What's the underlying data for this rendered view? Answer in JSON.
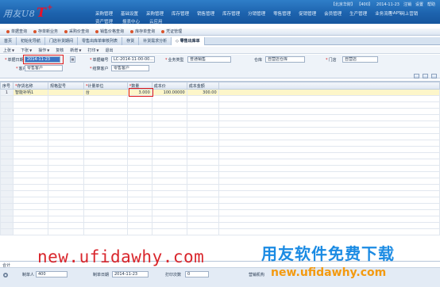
{
  "app": {
    "logo_text": "用友U8",
    "logo_mark": "T",
    "logo_plus": "+",
    "user_bar": [
      "【北京华财】",
      "【400】",
      "2014-11-23",
      "注销",
      "设置",
      "帮助"
    ],
    "shortcut": "T-APS"
  },
  "topnav": {
    "row1": [
      "采购管理",
      "基础设置",
      "采购管理",
      "库存管理",
      "销售管理",
      "库存管理",
      "分销管理",
      "零售管理",
      "促销管理",
      "会员管理",
      "生产管理",
      "业务流程",
      "网上营销"
    ],
    "row2": [
      "资产管理",
      "报表中心",
      "云应用"
    ]
  },
  "quickbar": {
    "items": [
      "单据查询",
      "存单新业务",
      "采购价查询",
      "销售价格查询",
      "库存单查询",
      "凭证管理"
    ]
  },
  "tabs": {
    "items": [
      "首页",
      "初始化导航",
      "门店补货期间",
      "零售出库单审核列表",
      "存货",
      "补货需求分析",
      "零售出库单"
    ],
    "active_index": 6
  },
  "toolbar": {
    "items": [
      {
        "label": "上张",
        "caret": true
      },
      {
        "label": "下张",
        "caret": true
      },
      {
        "label": "操作",
        "caret": true
      },
      {
        "label": "复核",
        "caret": false
      },
      {
        "label": "新增",
        "caret": true
      },
      {
        "label": "打印",
        "caret": true
      },
      {
        "label": "退出",
        "caret": false
      }
    ]
  },
  "form": {
    "date_label": "单据日期",
    "date_value": "2014-11-23",
    "code_label": "单据编号",
    "code_value": "LC-2014-11-00-00...",
    "biz_type_label": "业务类型",
    "biz_type_value": "普通销售",
    "warehouse_label": "仓库",
    "warehouse_value": "自营店仓库",
    "store_label": "门店",
    "store_value": "自营店",
    "customer_label": "客户",
    "customer_value": "零售客户",
    "settle_customer_label": "结算客户",
    "settle_customer_value": "零售客户"
  },
  "grid": {
    "columns": [
      "序号",
      "存货名称",
      "规格型号",
      "计量单位",
      "数量",
      "成本价",
      "成本金额"
    ],
    "required_columns": [
      1,
      3,
      4
    ],
    "rows": [
      [
        "1",
        "智能补钙1",
        "",
        "台",
        "3.000",
        "100.00000",
        "300.00"
      ]
    ],
    "total_label": "合计"
  },
  "footer": {
    "maker_label": "制单人",
    "maker_value": "400",
    "make_date_label": "制单日期",
    "make_date_value": "2014-11-23",
    "print_count_label": "打印次数",
    "print_count_value": "0",
    "sales_org_label": "营销机构"
  },
  "watermark": {
    "left": "new.ufidawhy.com",
    "right_title": "用友软件免费下载",
    "right_url": "new.ufidawhy.com"
  },
  "colors": {
    "banner": "#1d63ae",
    "highlight_box": "#e01a1a",
    "selected_row": "#fdf6c9",
    "watermark_red": "#d9262c",
    "watermark_blue": "#1b8be3",
    "watermark_orange": "#f39a10"
  }
}
